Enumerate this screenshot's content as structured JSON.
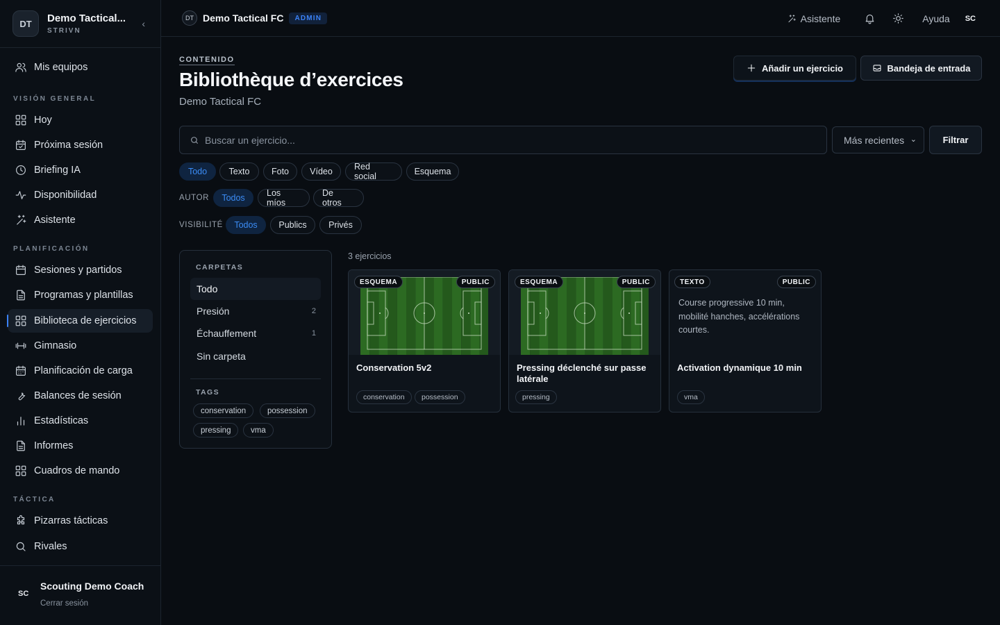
{
  "sidebar": {
    "team_initials": "DT",
    "team_name": "Demo Tactical...",
    "team_sub": "STRIVN",
    "collapse_glyph": "‹",
    "my_teams": "Mis equipos",
    "section_overview": "VISIÓN GENERAL",
    "overview_items": [
      "Hoy",
      "Próxima sesión",
      "Briefing IA",
      "Disponibilidad",
      "Asistente"
    ],
    "section_planning": "PLANIFICACIÓN",
    "planning_items": [
      "Sesiones y partidos",
      "Programas y plantillas",
      "Biblioteca de ejercicios",
      "Gimnasio",
      "Planificación de carga",
      "Balances de sesión",
      "Estadísticas",
      "Informes",
      "Cuadros de mando"
    ],
    "section_tactics": "TÁCTICA",
    "tactics_items": [
      "Pizarras tácticas",
      "Rivales"
    ],
    "user_initials": "SC",
    "user_name": "Scouting Demo Coach",
    "logout": "Cerrar sesión"
  },
  "topbar": {
    "team_initials": "DT",
    "team_name": "Demo Tactical FC",
    "role": "ADMIN",
    "assistant": "Asistente",
    "help": "Ayuda",
    "user_initials": "SC"
  },
  "header": {
    "kicker": "CONTENIDO",
    "title": "Bibliothèque d’exercices",
    "subtitle": "Demo Tactical FC",
    "add_button": "Añadir un ejercicio",
    "inbox_button": "Bandeja de entrada"
  },
  "search": {
    "placeholder": "Buscar un ejercicio...",
    "sort_value": "Más recientes",
    "filter_button": "Filtrar"
  },
  "filters": {
    "types": [
      "Todo",
      "Texto",
      "Foto",
      "Vídeo",
      "Red social",
      "Esquema"
    ],
    "author_label": "AUTOR",
    "authors": [
      "Todos",
      "Los míos",
      "De otros"
    ],
    "visibility_label": "VISIBILITÉ",
    "visibility": [
      "Todos",
      "Publics",
      "Privés"
    ]
  },
  "folders": {
    "label": "CARPETAS",
    "items": [
      {
        "name": "Todo",
        "count": ""
      },
      {
        "name": "Presión",
        "count": "2"
      },
      {
        "name": "Échauffement",
        "count": "1"
      },
      {
        "name": "Sin carpeta",
        "count": ""
      }
    ],
    "tags_label": "TAGS",
    "tags": [
      "conservation",
      "possession",
      "pressing",
      "vma"
    ]
  },
  "results": {
    "count": "3 ejercicios",
    "cards": [
      {
        "type": "ESQUEMA",
        "visibility": "PUBLIC",
        "title": "Conservation 5v2",
        "text": "",
        "tags": [
          "conservation",
          "possession"
        ]
      },
      {
        "type": "ESQUEMA",
        "visibility": "PUBLIC",
        "title": "Pressing déclenché sur passe latérale",
        "text": "",
        "tags": [
          "pressing"
        ]
      },
      {
        "type": "TEXTO",
        "visibility": "PUBLIC",
        "title": "Activation dynamique 10 min",
        "text": "Course progressive 10 min, mobilité hanches, accélérations courtes.",
        "tags": [
          "vma"
        ]
      }
    ]
  },
  "colors": {
    "accent": "#3b82f6",
    "pitch": "#2c6a22",
    "background": "#090d12"
  }
}
